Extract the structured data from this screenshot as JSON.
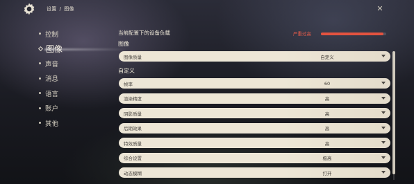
{
  "header": {
    "breadcrumb_settings": "设置",
    "breadcrumb_sep": "/",
    "breadcrumb_current": "图像",
    "close_glyph": "✕"
  },
  "nav": {
    "items": [
      {
        "label": "控制",
        "active": false
      },
      {
        "label": "图像",
        "active": true
      },
      {
        "label": "声音",
        "active": false
      },
      {
        "label": "消息",
        "active": false
      },
      {
        "label": "语言",
        "active": false
      },
      {
        "label": "账户",
        "active": false
      },
      {
        "label": "其他",
        "active": false
      }
    ]
  },
  "device_load": {
    "title": "当前配置下的设备负载",
    "warning": "严重过高",
    "level": 0.96,
    "color": "#e4533f"
  },
  "sections": {
    "graphics": "图像",
    "custom": "自定义"
  },
  "settings": {
    "graphics_quality": {
      "label": "图像质量",
      "value": "自定义"
    },
    "custom": [
      {
        "label": "帧率",
        "value": "60"
      },
      {
        "label": "渲染精度",
        "value": "高"
      },
      {
        "label": "阴影质量",
        "value": "高"
      },
      {
        "label": "后期效果",
        "value": "高"
      },
      {
        "label": "特效质量",
        "value": "高"
      },
      {
        "label": "综合设置",
        "value": "极高"
      },
      {
        "label": "动态模糊",
        "value": "打开"
      }
    ]
  },
  "icons": {
    "settings": "gear-icon",
    "close": "close-icon",
    "dropdown": "chevron-down-icon"
  }
}
